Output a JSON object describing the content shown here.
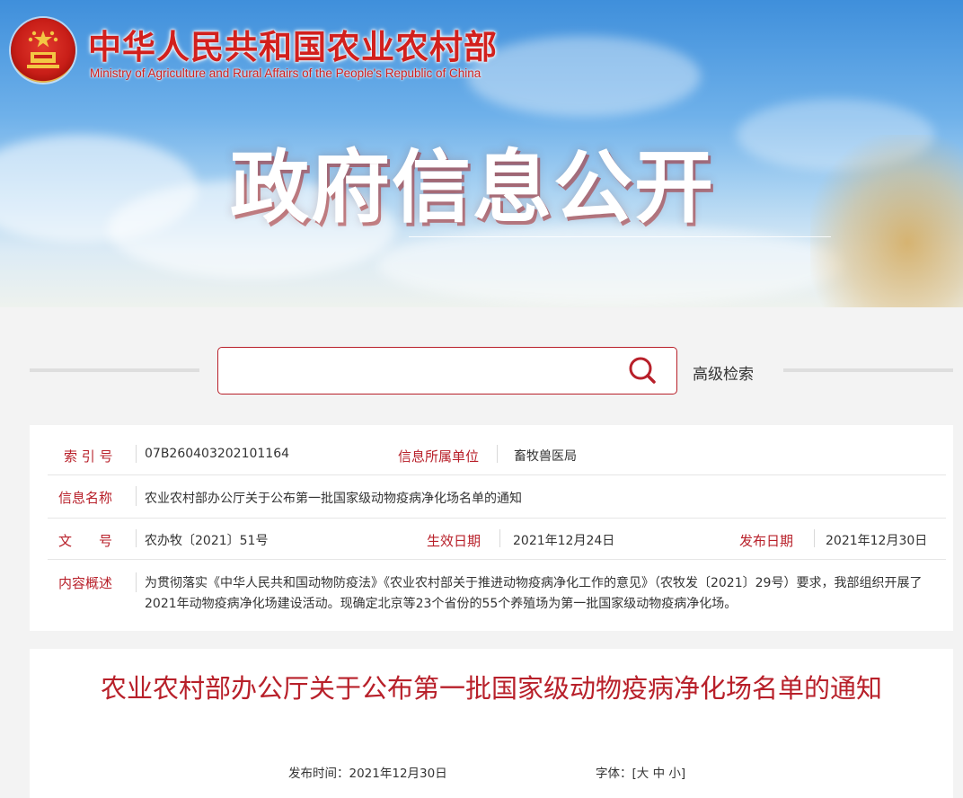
{
  "header": {
    "ministry_cn": "中华人民共和国农业农村部",
    "ministry_en": "Ministry of Agriculture and Rural Affairs of the People's Republic of China",
    "section_title": "政府信息公开"
  },
  "search": {
    "placeholder": "",
    "advanced_label": "高级检索"
  },
  "info": {
    "index_label": "索 引 号",
    "index_value": "07B260403202101164",
    "unit_label": "信息所属单位",
    "unit_value": "畜牧兽医局",
    "name_label": "信息名称",
    "name_value": "农业农村部办公厅关于公布第一批国家级动物疫病净化场名单的通知",
    "doc_label": "文　　号",
    "doc_value": "农办牧〔2021〕51号",
    "effective_label": "生效日期",
    "effective_value": "2021年12月24日",
    "publish_label": "发布日期",
    "publish_value": "2021年12月30日",
    "summary_label": "内容概述",
    "summary_value": "为贯彻落实《中华人民共和国动物防疫法》《农业农村部关于推进动物疫病净化工作的意见》（农牧发〔2021〕29号）要求，我部组织开展了2021年动物疫病净化场建设活动。现确定北京等23个省份的55个养殖场为第一批国家级动物疫病净化场。"
  },
  "article": {
    "title": "农业农村部办公厅关于公布第一批国家级动物疫病净化场名单的通知",
    "publish_time": "发布时间：2021年12月30日",
    "font_label": "字体：[",
    "font_large": "大",
    "font_medium": "中",
    "font_small": "小",
    "font_close": "]"
  },
  "colors": {
    "accent": "#b8202a",
    "ministry_red": "#d2201d"
  },
  "icons": {
    "emblem": "national-emblem-icon",
    "search": "search-icon"
  }
}
